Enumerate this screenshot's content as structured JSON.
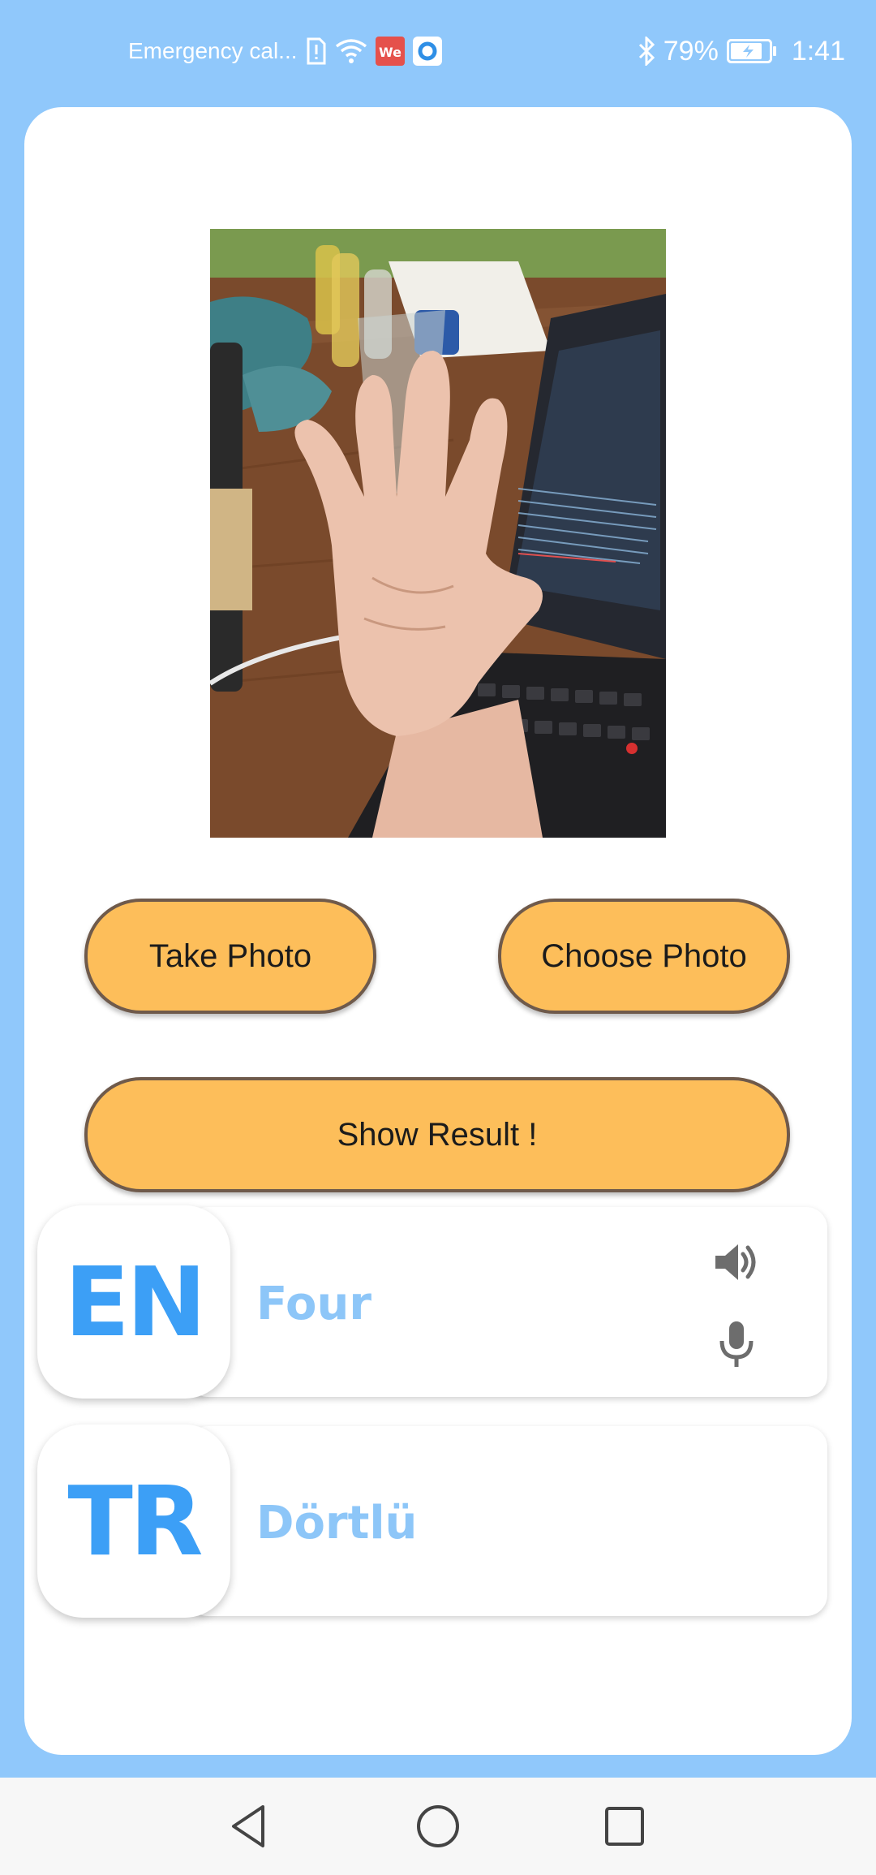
{
  "status_bar": {
    "carrier": "Emergency cal...",
    "battery_percent": "79%",
    "time": "1:41",
    "icons": [
      "sim-alert-icon",
      "wifi-icon",
      "weibo-app-icon",
      "app-notification-icon",
      "bluetooth-icon",
      "battery-charging-icon"
    ]
  },
  "buttons": {
    "take_photo": "Take Photo",
    "choose_photo": "Choose Photo",
    "show_result": "Show Result !"
  },
  "results": {
    "english": {
      "code": "EN",
      "word": "Four"
    },
    "turkish": {
      "code": "TR",
      "word": "Dörtlü"
    }
  },
  "icons": {
    "speak": "speaker-icon",
    "listen": "microphone-icon"
  },
  "navigation": [
    "back-icon",
    "home-icon",
    "recent-apps-icon"
  ],
  "colors": {
    "background": "#90c8fb",
    "button_fill": "#fdbe5a",
    "button_border": "#6f5a4b",
    "badge_text": "#3c9ff6",
    "word_text": "#8dc6f8"
  }
}
